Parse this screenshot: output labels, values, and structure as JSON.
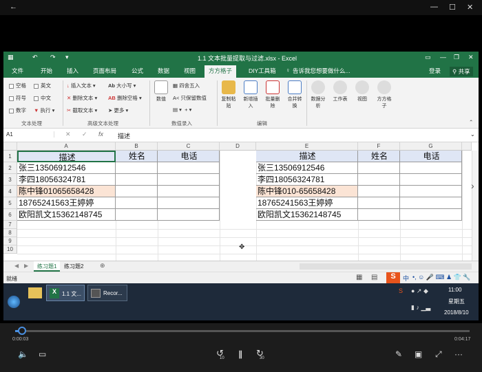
{
  "excel": {
    "window_title": "1.1 文本批量提取与过滤.xlsx - Excel",
    "menu": [
      "文件",
      "开始",
      "插入",
      "页面布局",
      "公式",
      "数据",
      "视图",
      "方方格子",
      "DIY工具箱"
    ],
    "active_menu": "方方格子",
    "tell_me": "告诉我您想要做什么...",
    "login": "登录",
    "share": "共享",
    "ribbon": {
      "text_group": {
        "label": "文本处理",
        "checks": [
          "空格",
          "英文",
          "符号",
          "中文",
          "数字"
        ],
        "execute": "执行"
      },
      "adv_group": {
        "label": "高级文本处理",
        "items": [
          "插入文本",
          "删除文本",
          "截取文本",
          "大小写",
          "删除空格",
          "更多"
        ]
      },
      "num_group": {
        "label": "数值录入",
        "value_btn": "数值",
        "items": [
          "四舍五入",
          "只保留数值"
        ]
      },
      "edit_group": {
        "label": "编辑",
        "buttons": [
          "复制粘贴",
          "新增插入",
          "批量删除",
          "合并转换"
        ]
      },
      "other_buttons": [
        "数据分析",
        "工作表",
        "视图",
        "方方格子"
      ]
    },
    "name_box": "A1",
    "formula": "描述",
    "columns_left": [
      "A",
      "B",
      "C",
      "D"
    ],
    "columns_right": [
      "E",
      "F",
      "G"
    ],
    "row_numbers": [
      "1",
      "2",
      "3",
      "4",
      "5",
      "6",
      "7",
      "8",
      "9",
      "10"
    ],
    "table_left": {
      "headers": [
        "描述",
        "姓名",
        "电话"
      ],
      "rows": [
        "张三13506912546",
        "李四18056324781",
        "陈中锋01065658428",
        "18765241563王婷婷",
        "欧阳凯文15362148745"
      ]
    },
    "table_right": {
      "headers": [
        "描述",
        "姓名",
        "电话"
      ],
      "rows": [
        "张三13506912546",
        "李四18056324781",
        "陈中锋010-65658428",
        "18765241563王婷婷",
        "欧阳凯文15362148745"
      ]
    },
    "sheets": [
      "练习题1",
      "练习题2"
    ],
    "status": "就绪",
    "ime_label": "中"
  },
  "taskbar": {
    "apps": [
      "1.1 文...",
      "Recor..."
    ],
    "time": "11:00",
    "weekday": "星期五",
    "date": "2018/8/10"
  },
  "player": {
    "elapsed": "0:00:03",
    "total": "0:04:17",
    "progress": 0.012,
    "skip_back": "10",
    "skip_fwd": "30"
  },
  "colors": {
    "excel_green": "#217346",
    "header_fill": "#dfe6f5",
    "highlight_fill": "#fbe4d5"
  }
}
